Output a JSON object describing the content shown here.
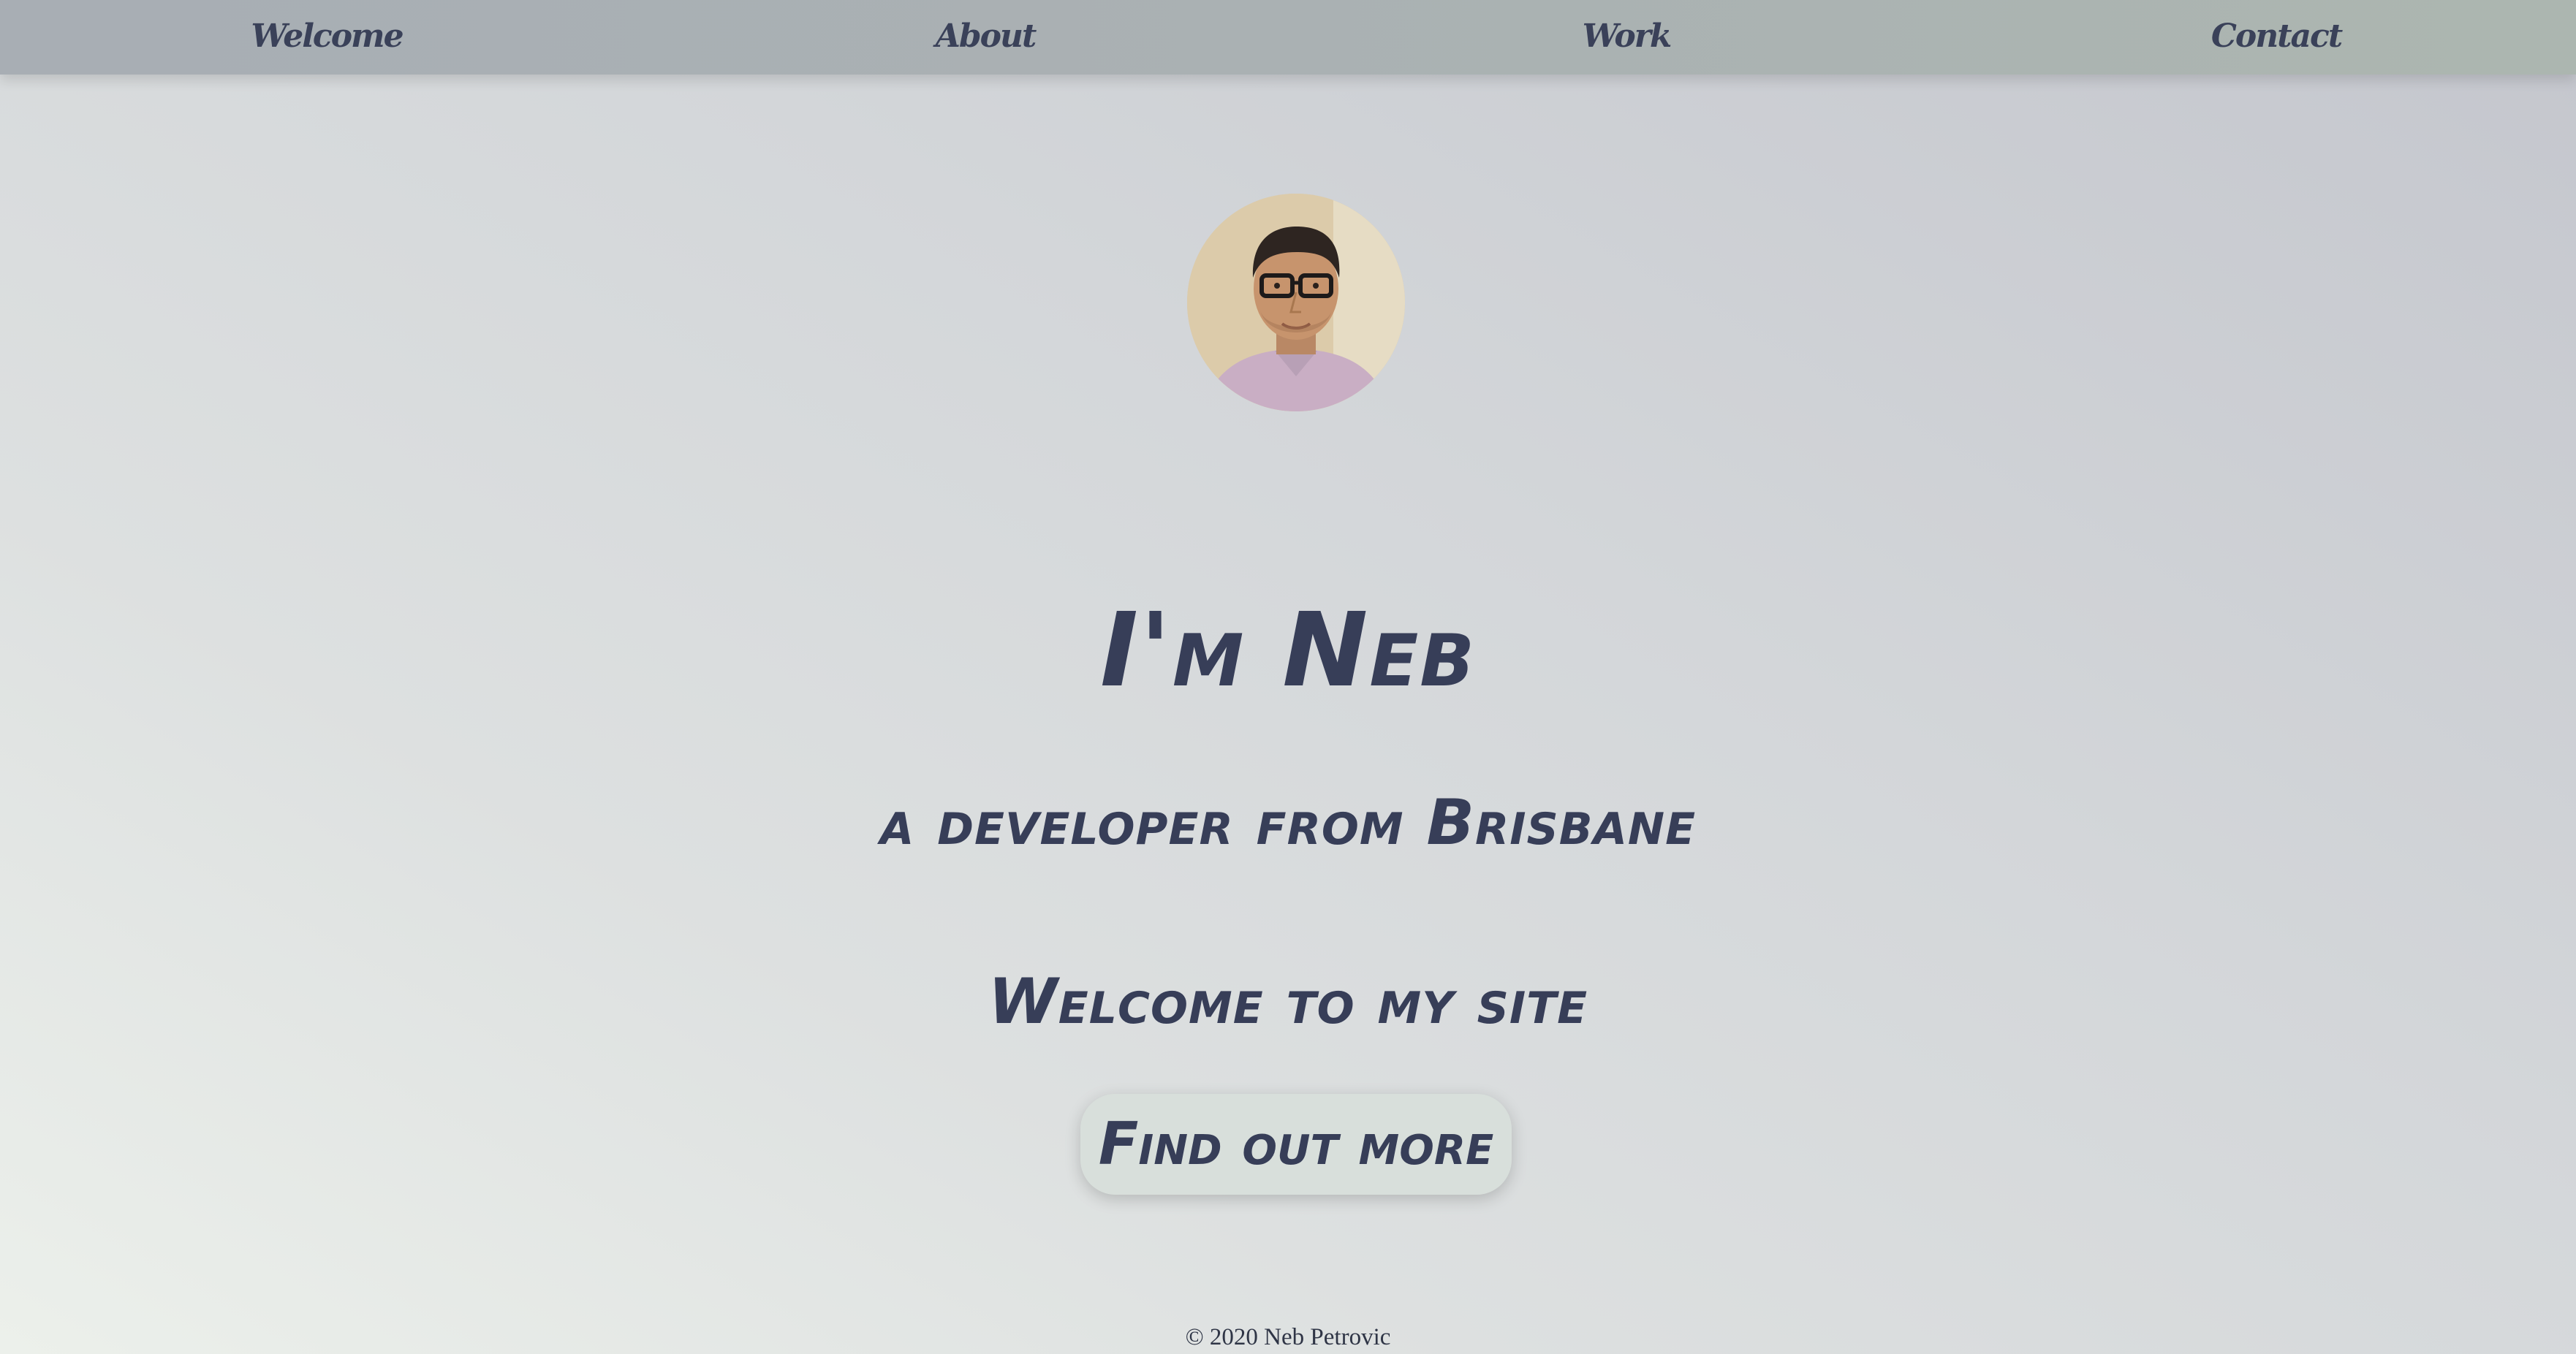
{
  "nav": {
    "items": [
      {
        "label": "Welcome"
      },
      {
        "label": "About"
      },
      {
        "label": "Work"
      },
      {
        "label": "Contact"
      }
    ]
  },
  "hero": {
    "avatar_alt": "Neb Petrovic portrait",
    "heading": "I'm Neb",
    "subheading": "a developer from Brisbane",
    "welcome": "Welcome to my site",
    "cta_label": "Find out more"
  },
  "footer": {
    "text": "© 2020 Neb Petrovic"
  },
  "colors": {
    "text": "#373e58",
    "navbar": "#aab1b3",
    "button_bg": "#d8dfdb"
  }
}
